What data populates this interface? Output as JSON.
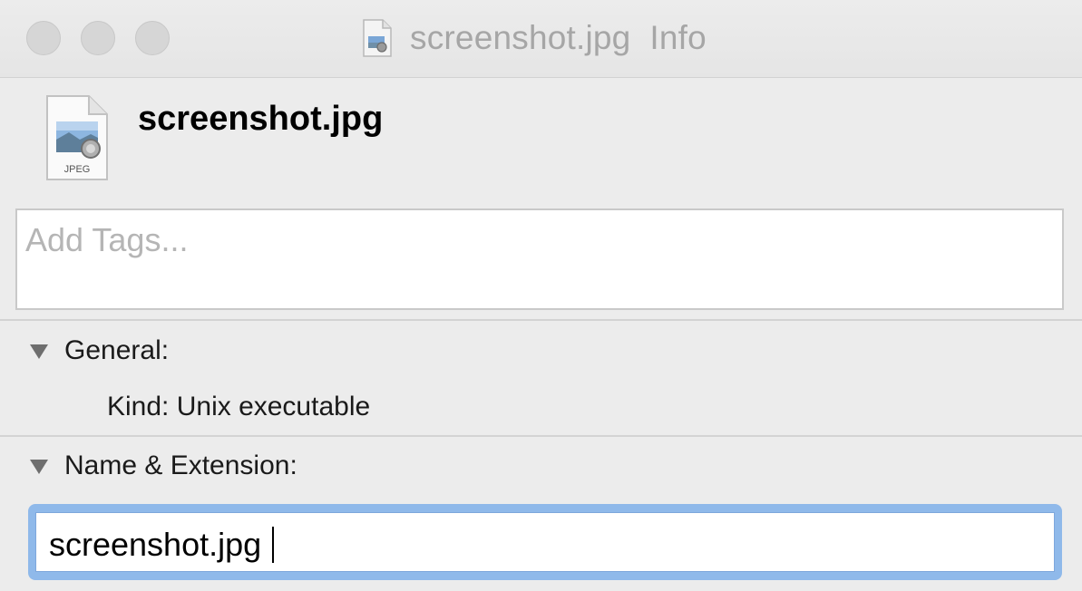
{
  "window": {
    "title": "screenshot.jpg  Info",
    "title_icon": "jpeg-document-icon"
  },
  "header": {
    "file_name": "screenshot.jpg",
    "file_icon": "jpeg-file-icon",
    "file_icon_label": "JPEG"
  },
  "tags": {
    "placeholder": "Add Tags..."
  },
  "general": {
    "heading": "General:",
    "kind_label": "Kind:",
    "kind_value": "Unix executable",
    "kind_row": "Kind: Unix executable"
  },
  "name_extension": {
    "heading": "Name & Extension:",
    "value": "screenshot.jpg"
  },
  "colors": {
    "focus_ring": "#8fb9ea",
    "window_bg": "#ececec",
    "title_text": "#a6a6a6"
  }
}
